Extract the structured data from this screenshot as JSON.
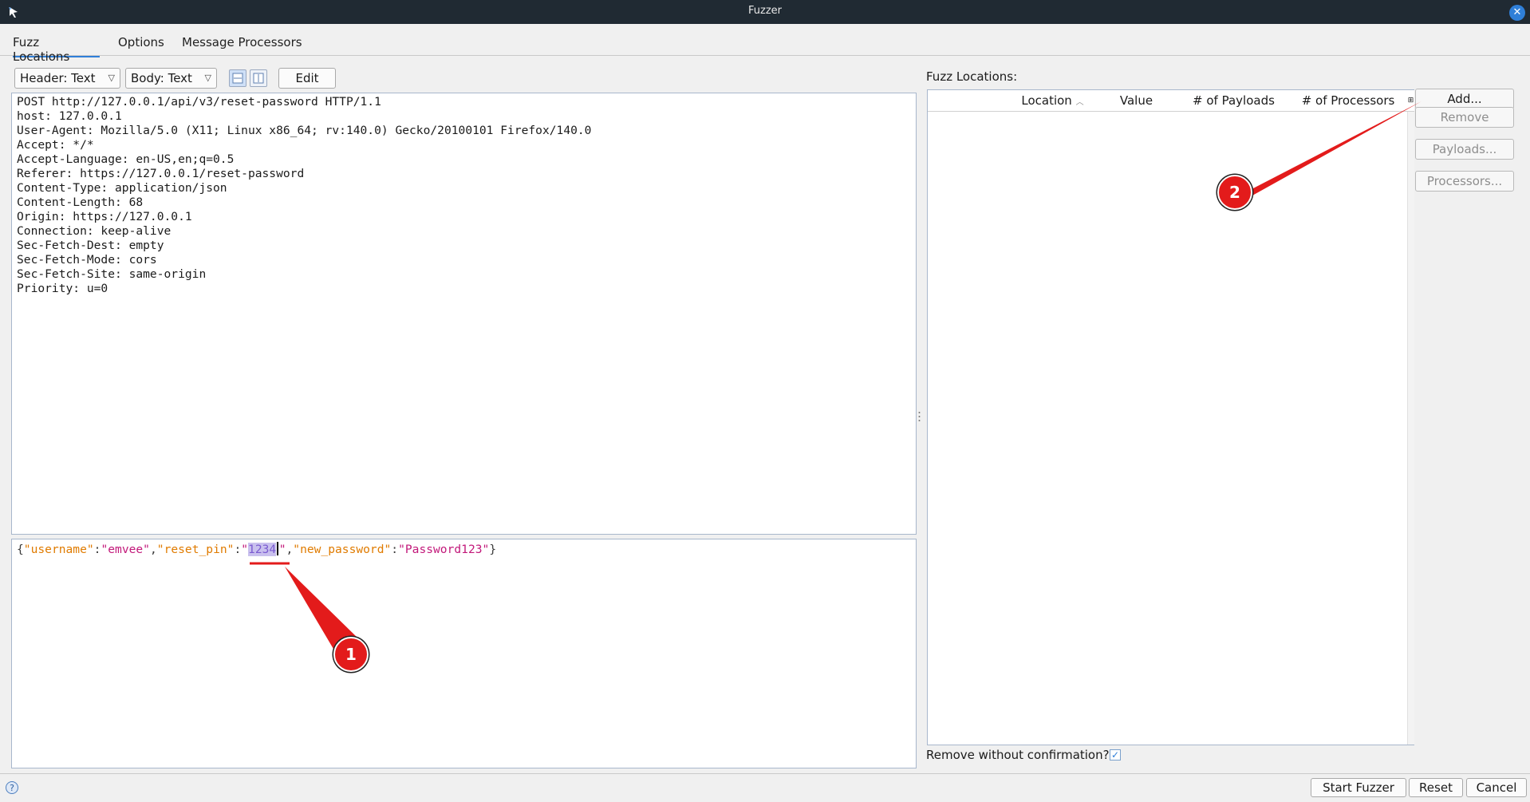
{
  "window": {
    "title": "Fuzzer"
  },
  "tabs": [
    {
      "label": "Fuzz Locations",
      "active": true
    },
    {
      "label": "Options",
      "active": false
    },
    {
      "label": "Message Processors",
      "active": false
    }
  ],
  "toolbar": {
    "header_view": "Header: Text",
    "body_view": "Body: Text",
    "edit_label": "Edit"
  },
  "request": {
    "header_lines": [
      "POST http://127.0.0.1/api/v3/reset-password HTTP/1.1",
      "host: 127.0.0.1",
      "User-Agent: Mozilla/5.0 (X11; Linux x86_64; rv:140.0) Gecko/20100101 Firefox/140.0",
      "Accept: */*",
      "Accept-Language: en-US,en;q=0.5",
      "Referer: https://127.0.0.1/reset-password",
      "Content-Type: application/json",
      "Content-Length: 68",
      "Origin: https://127.0.0.1",
      "Connection: keep-alive",
      "Sec-Fetch-Dest: empty",
      "Sec-Fetch-Mode: cors",
      "Sec-Fetch-Site: same-origin",
      "Priority: u=0"
    ],
    "body": {
      "open": "{",
      "k1": "\"username\"",
      "v1": "\"emvee\"",
      "k2": "\"reset_pin\"",
      "v2_open": "\"",
      "v2_selected": "1234",
      "v2_close": "\"",
      "k3": "\"new_password\"",
      "v3": "\"Password123\"",
      "close": "}",
      "colon": ":",
      "comma": ","
    }
  },
  "fuzz_locations": {
    "label": "Fuzz Locations:",
    "columns": [
      "",
      "Location",
      "Value",
      "# of Payloads",
      "# of Processors"
    ],
    "sort_column": "Location",
    "rows": [],
    "remove_without_confirmation_label": "Remove without confirmation?",
    "remove_without_confirmation_checked": true
  },
  "side_buttons": {
    "add": "Add...",
    "remove": "Remove",
    "payloads": "Payloads...",
    "processors": "Processors..."
  },
  "bottom_buttons": {
    "start": "Start Fuzzer",
    "reset": "Reset",
    "cancel": "Cancel"
  },
  "annotations": [
    {
      "label": "1"
    },
    {
      "label": "2"
    }
  ],
  "colors": {
    "json_key": "#e07b00",
    "json_string": "#c2187a",
    "selection": "#c9c0ee",
    "callout": "#e31b1b",
    "accent": "#2f7fd8"
  }
}
